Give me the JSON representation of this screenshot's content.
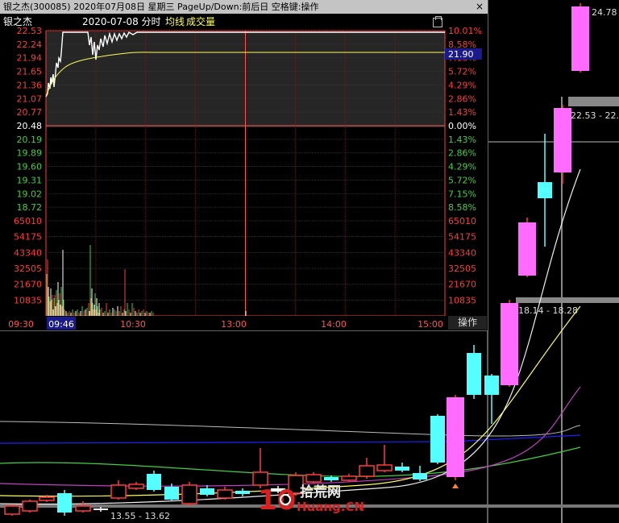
{
  "window_title": "银之杰(300085)  2020年07月08日  星期三  PageUp/Down:前后日  空格键:操作",
  "close_symbol": "×",
  "info": {
    "name": "银之杰",
    "date_label": "2020-07-08 分时",
    "avg_label": "均线",
    "vol_label": "成交量"
  },
  "colors": {
    "up": "#ff3b3b",
    "down": "#5ff",
    "flat": "#ffffff",
    "pink": "#ff6bff",
    "yellow": "#ffff55",
    "blue": "#2020ff",
    "green": "#40d040",
    "magenta": "#c040c0"
  },
  "left_axis": {
    "price_labels": [
      "22.53",
      "22.24",
      "21.94",
      "21.65",
      "21.36",
      "21.07",
      "20.77",
      "20.48",
      "20.19",
      "19.89",
      "19.60",
      "19.31",
      "19.02",
      "18.72"
    ],
    "volume_labels": [
      "65010",
      "54175",
      "43340",
      "32505",
      "21670",
      "10835"
    ]
  },
  "right_axis": {
    "pct_labels": [
      "10.01%",
      "8.58%",
      "7.15%",
      "5.72%",
      "4.29%",
      "2.86%",
      "1.43%",
      "0.00%",
      "1.43%",
      "2.86%",
      "4.29%",
      "5.72%",
      "7.15%",
      "8.58%"
    ],
    "volume_labels": [
      "65010",
      "54175",
      "43340",
      "32505",
      "21670",
      "10835"
    ],
    "current_price": "21.90"
  },
  "time_axis": {
    "labels": [
      "09:30",
      "09:46",
      "10:30",
      "13:00",
      "14:00",
      "15:00"
    ]
  },
  "operate_label": "操作",
  "kline_labels": {
    "high_top": "24.78",
    "range_1": "22.53 - 22.",
    "range_2": "18.14 - 18.28",
    "low_range": "13.55 - 13.62"
  },
  "watermark": {
    "number": "10",
    "text_cn": "拾荒网",
    "text_en": "Huang.CN"
  }
}
